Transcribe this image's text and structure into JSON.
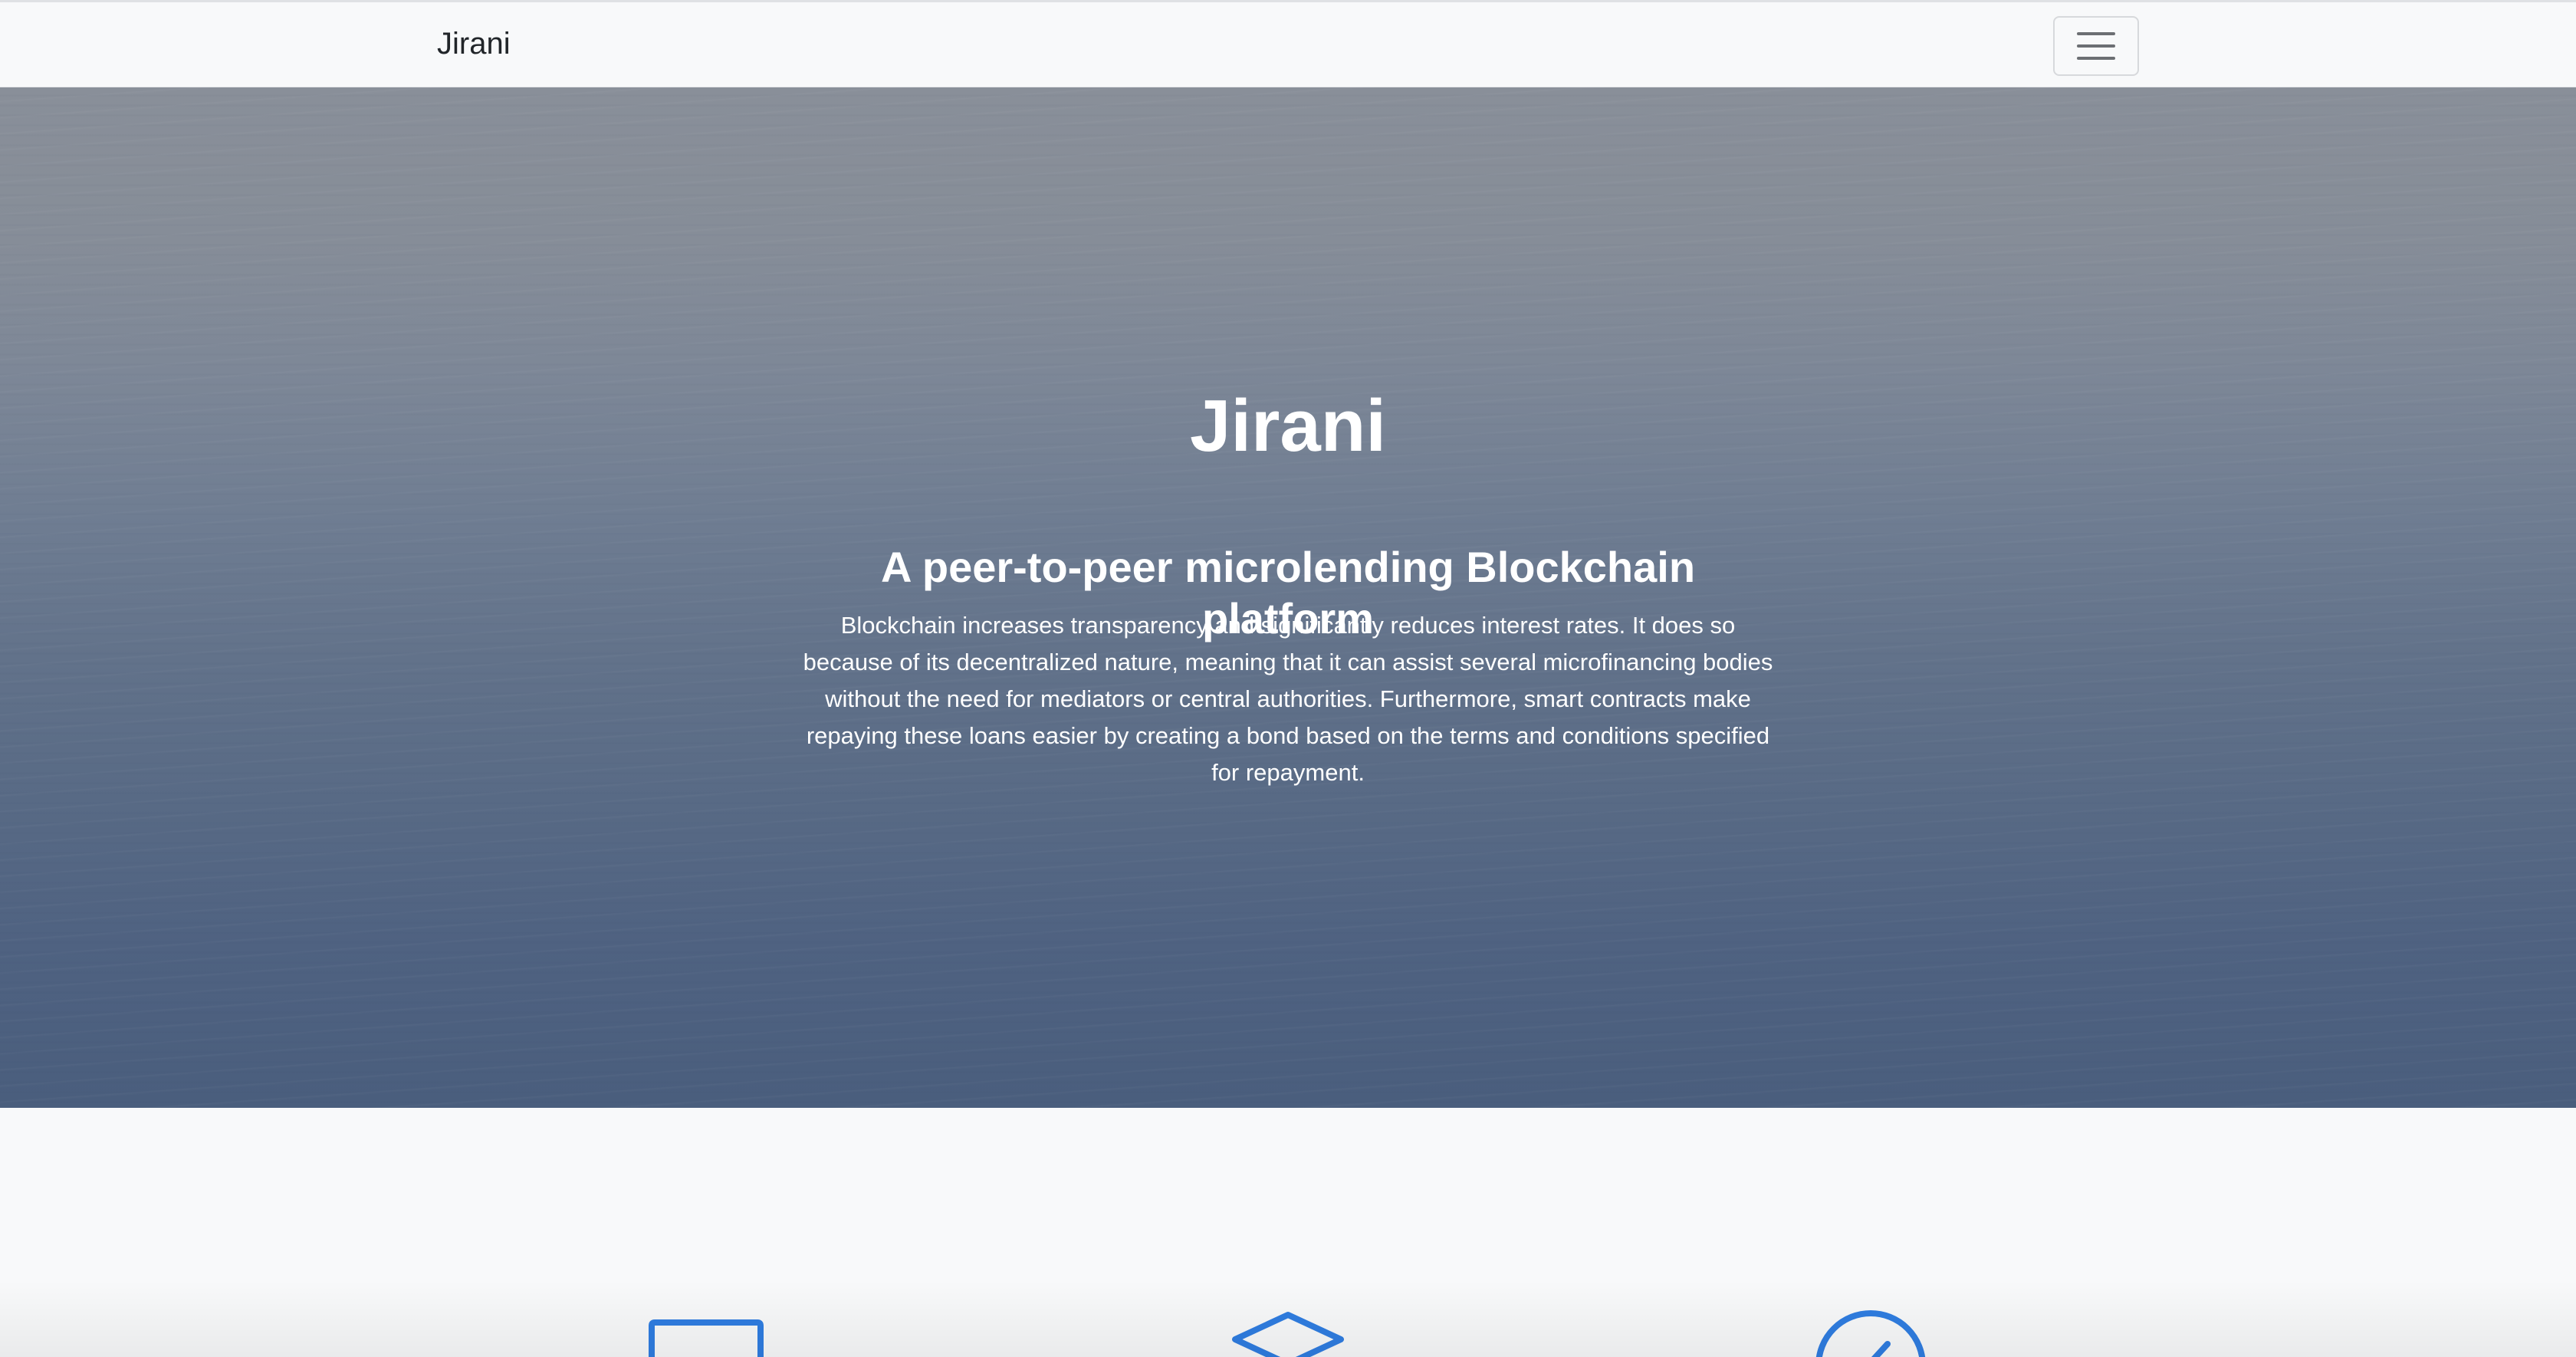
{
  "navbar": {
    "brand": "Jirani",
    "toggler_icon": "hamburger-menu-icon"
  },
  "hero": {
    "title": "Jirani",
    "subtitle": "A peer-to-peer microlending Blockchain platform",
    "description": "Blockchain increases transparency and significantly reduces interest rates. It does so because of its decentralized nature, meaning that it can assist several microfinancing bodies without the need for mediators or central authorities. Furthermore, smart contracts make repaying these loans easier by creating a bond based on the terms and conditions specified for repayment."
  },
  "features": {
    "icons": [
      "monitor-icon",
      "layers-icon",
      "check-circle-icon"
    ],
    "accent_color": "#2f7de1"
  }
}
